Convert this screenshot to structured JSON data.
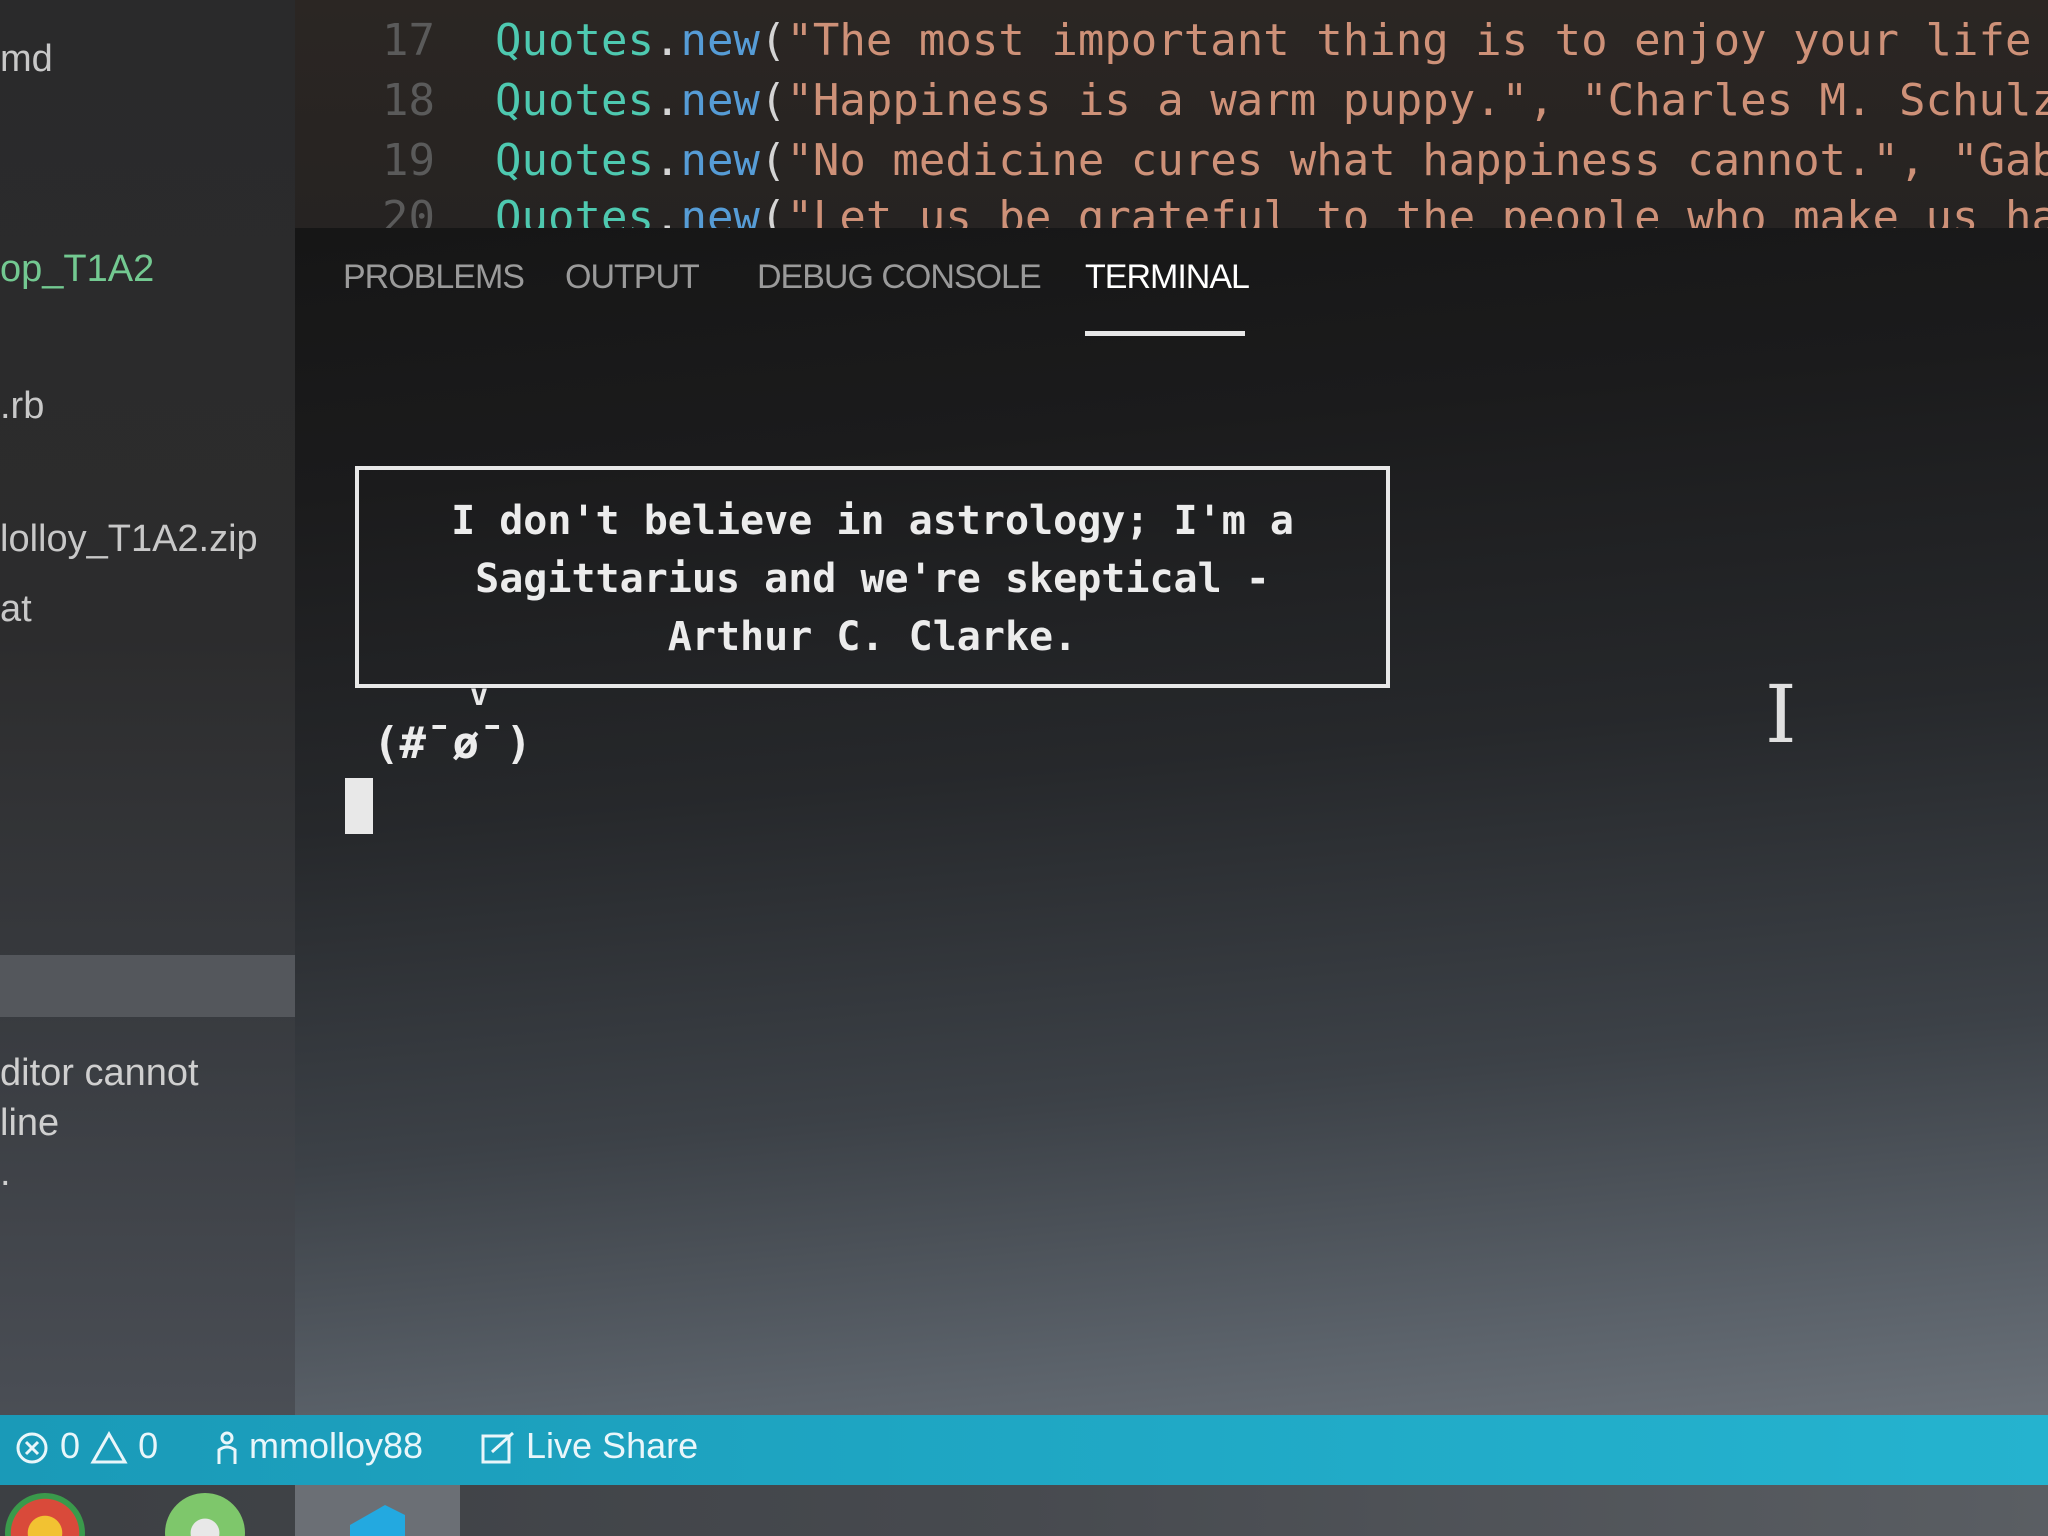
{
  "sidebar": {
    "items": [
      {
        "label": "md",
        "color": "#c8c8c8"
      },
      {
        "label": "op_T1A2",
        "color": "#73c991"
      },
      {
        "label": ".rb",
        "color": "#c8c8c8"
      },
      {
        "label": "lolloy_T1A2.zip",
        "color": "#c8c8c8"
      },
      {
        "label": "at",
        "color": "#c8c8c8"
      }
    ],
    "notice_lines": [
      "ditor cannot",
      "line",
      "."
    ]
  },
  "editor": {
    "lines": [
      {
        "number": "17",
        "class": "Quotes",
        "method": "new",
        "text": "\"The most important thing is to enjoy your life"
      },
      {
        "number": "18",
        "class": "Quotes",
        "method": "new",
        "text": "\"Happiness is a warm puppy.\", \"Charles M. Schulz"
      },
      {
        "number": "19",
        "class": "Quotes",
        "method": "new",
        "text": "\"No medicine cures what happiness cannot.\", \"Gab"
      },
      {
        "number": "20",
        "class": "Quotes",
        "method": "new",
        "text": "\"Let us be grateful to the people who make us ha"
      }
    ]
  },
  "panel": {
    "tabs": [
      "PROBLEMS",
      "OUTPUT",
      "DEBUG CONSOLE",
      "TERMINAL"
    ],
    "active_tab": "TERMINAL"
  },
  "terminal": {
    "quote_lines": [
      "I don't believe in astrology; I'm a",
      "Sagittarius and we're skeptical -",
      "Arthur C. Clarke."
    ],
    "speech_tail": "v",
    "face": "(#¯ø¯)"
  },
  "statusbar": {
    "errors": "0",
    "warnings": "0",
    "user": "mmolloy88",
    "live_share": "Live Share"
  },
  "colors": {
    "statusbar": "#1fa7c4",
    "accent_green": "#73c991",
    "string": "#ce9178"
  }
}
